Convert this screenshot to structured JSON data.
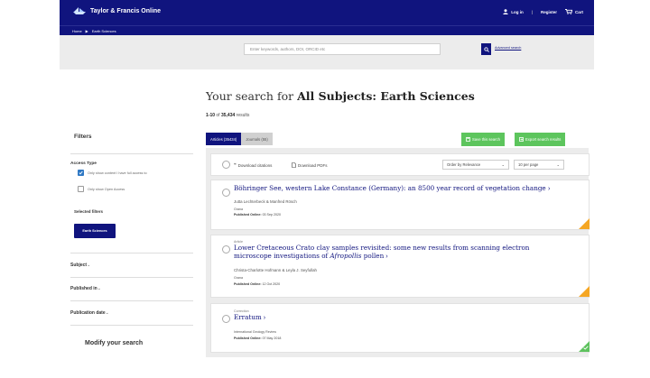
{
  "header": {
    "brand": "Taylor & Francis Online",
    "login": "Log in",
    "register": "Register",
    "cart": "Cart"
  },
  "breadcrumb": {
    "home": "Home",
    "separator": "▶",
    "current": "Earth Sciences"
  },
  "search": {
    "placeholder": "Enter keywords, authors, DOI, ORCID etc",
    "advanced": "Advanced search"
  },
  "headline": {
    "prefix": "Your search for ",
    "subject": "All Subjects: Earth Sciences"
  },
  "result_count": {
    "range": "1-10",
    "of": " of ",
    "total": "35,434",
    "suffix": " results"
  },
  "sidebar": {
    "filters_title": "Filters",
    "access_type": "Access Type",
    "access_option_1": "Only show content I have full access to",
    "access_option_2": "Only show Open Access",
    "selected_filters": "Selected filters",
    "chip": "Earth Sciences",
    "facet_subject": "Subject",
    "facet_published": "Published in",
    "facet_date": "Publication date",
    "modify": "Modify your search"
  },
  "tabs": {
    "articles": "Articles (35434)",
    "journals": "Journals (55)"
  },
  "actions": {
    "save": "Save this search",
    "export": "Export search results"
  },
  "toolbar": {
    "download_citations": "Download citations",
    "download_pdfs": "Download PDFs",
    "order": "Order by Relevance",
    "per_page": "10 per page"
  },
  "colors": {
    "brand_navy": "#10147e",
    "action_green": "#5dc55d",
    "access_orange": "#f5a623",
    "access_green": "#5ec25e"
  },
  "results": [
    {
      "type": "",
      "title": "Böhringer See, western Lake Constance (Germany): an 8500 year record of vegetation change",
      "authors": "Jutta Lechterbeck & Manfred Rösch",
      "journal": "Grana",
      "published_label": "Published Online:",
      "published_date": "03 Sep 2020",
      "access": "orange"
    },
    {
      "type": "Article",
      "title_line1": "Lower Cretaceous Crato clay samples revisited: some new results from scanning electron",
      "title_line2_pre": "microscope investigations of ",
      "title_line2_em": "Afropollis",
      "title_line2_post": " pollen",
      "authors": "Christa-Charlotte Hofmann & Leyla J. Seyfullah",
      "journal": "Grana",
      "published_label": "Published Online:",
      "published_date": "12 Oct 2020",
      "access": "orange"
    },
    {
      "type": "Correction",
      "title": "Erratum",
      "journal": "International Geology Review",
      "published_label": "Published Online:",
      "published_date": "07 May 2018",
      "access": "green"
    }
  ]
}
